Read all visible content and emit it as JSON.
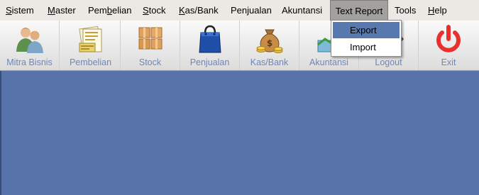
{
  "menubar": {
    "items": [
      {
        "label": "Sistem"
      },
      {
        "label": "Master"
      },
      {
        "label": "Pembelian"
      },
      {
        "label": "Stock"
      },
      {
        "label": "Kas/Bank"
      },
      {
        "label": "Penjualan"
      },
      {
        "label": "Akuntansi"
      },
      {
        "label": "Text Report"
      },
      {
        "label": "Tools"
      },
      {
        "label": "Help"
      }
    ]
  },
  "toolbar": {
    "buttons": [
      {
        "label": "Mitra Bisnis",
        "icon": "partners-icon"
      },
      {
        "label": "Pembelian",
        "icon": "purchase-documents-icon"
      },
      {
        "label": "Stock",
        "icon": "stock-boxes-icon"
      },
      {
        "label": "Penjualan",
        "icon": "shopping-bag-icon"
      },
      {
        "label": "Kas/Bank",
        "icon": "money-bag-icon"
      },
      {
        "label": "Akuntansi",
        "icon": "accounting-icon"
      },
      {
        "label": "Logout",
        "icon": "logout-icon"
      },
      {
        "label": "Exit",
        "icon": "power-icon"
      }
    ]
  },
  "dropdown": {
    "items": [
      {
        "label": "Export"
      },
      {
        "label": "Import"
      }
    ]
  },
  "colors": {
    "workspace": "#5773a9",
    "toolbar_label": "#6f86b8",
    "selected_item": "#5878b0",
    "exit_red": "#e8312f"
  }
}
